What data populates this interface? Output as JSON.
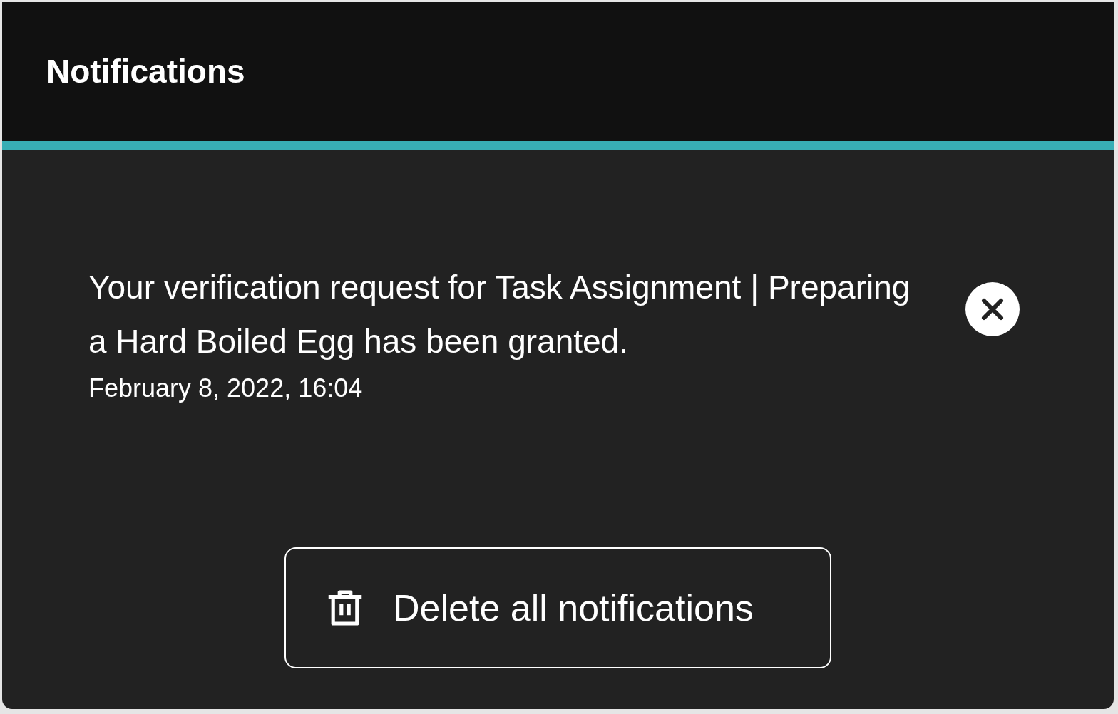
{
  "panel": {
    "title": "Notifications"
  },
  "notifications": [
    {
      "message": "Your verification request for Task Assignment | Preparing a Hard Boiled Egg has been granted.",
      "time": "February 8, 2022, 16:04"
    }
  ],
  "delete_all_button": {
    "label": "Delete all notifications"
  }
}
